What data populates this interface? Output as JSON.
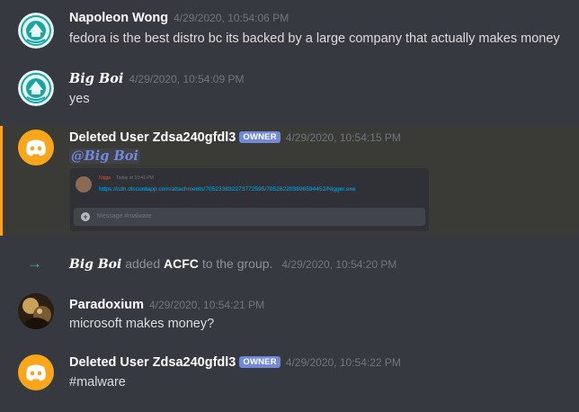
{
  "messages": [
    {
      "author": "Napoleon Wong",
      "timestamp": "4/29/2020, 10:54:06 PM",
      "text": "fedora is the best distro bc its backed by a large company that actually makes money"
    },
    {
      "author": "Big Boi",
      "timestamp": "4/29/2020, 10:54:09 PM",
      "text": "yes"
    },
    {
      "author": "Deleted User Zdsa240gfdl3",
      "badge": "OWNER",
      "timestamp": "4/29/2020, 10:54:15 PM",
      "mention": "@Big Boi",
      "embed": {
        "author": "Nigga",
        "timestamp": "Today at 10:41 PM",
        "link": "https://cdn.discordapp.com/attachments/705233832273772595/705262203896594452/Nigger.exe",
        "input_placeholder": "Message #malware"
      }
    },
    {
      "type": "system",
      "actor": "Big Boi",
      "action": "added",
      "target": "ACFC",
      "suffix": "to the group.",
      "timestamp": "4/29/2020, 10:54:20 PM"
    },
    {
      "author": "Paradoxium",
      "timestamp": "4/29/2020, 10:54:21 PM",
      "text": "microsoft makes money?"
    },
    {
      "author": "Deleted User Zdsa240gfdl3",
      "badge": "OWNER",
      "timestamp": "4/29/2020, 10:54:22 PM",
      "text": "#malware"
    }
  ],
  "colors": {
    "background": "#36393f",
    "highlight": "#3a3a37",
    "mention_border": "#faa61a",
    "owner_badge": "#7289da",
    "discord_avatar": "#faa61a",
    "system_arrow": "#43b581"
  },
  "icons": {
    "deleted_user_avatar": "discord-logo-icon",
    "system": "arrow-right-icon",
    "embed_plus": "plus-circle-icon"
  }
}
